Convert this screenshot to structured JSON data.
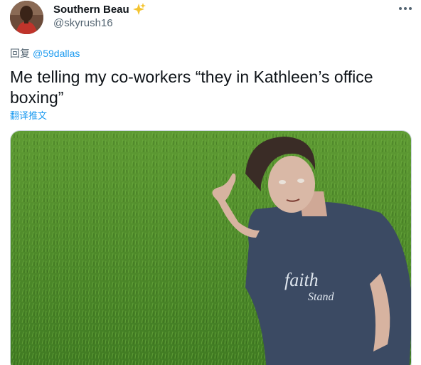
{
  "author": {
    "display_name": "Southern Beau",
    "handle": "@skyrush16",
    "badge_icon": "sparkles-icon"
  },
  "reply": {
    "prefix": "回复",
    "mention": "@59dallas"
  },
  "tweet": {
    "text": "Me telling my co-workers “they in Kathleen’s office boxing”",
    "translate_label": "翻译推文"
  },
  "media": {
    "shirt_line1": "faith",
    "shirt_line2": "Stand"
  },
  "colors": {
    "accent": "#1d9bf0",
    "secondary_text": "#536471",
    "primary_text": "#0f1419",
    "grass": "#4f8a2a",
    "shirt": "#3b4a63"
  }
}
